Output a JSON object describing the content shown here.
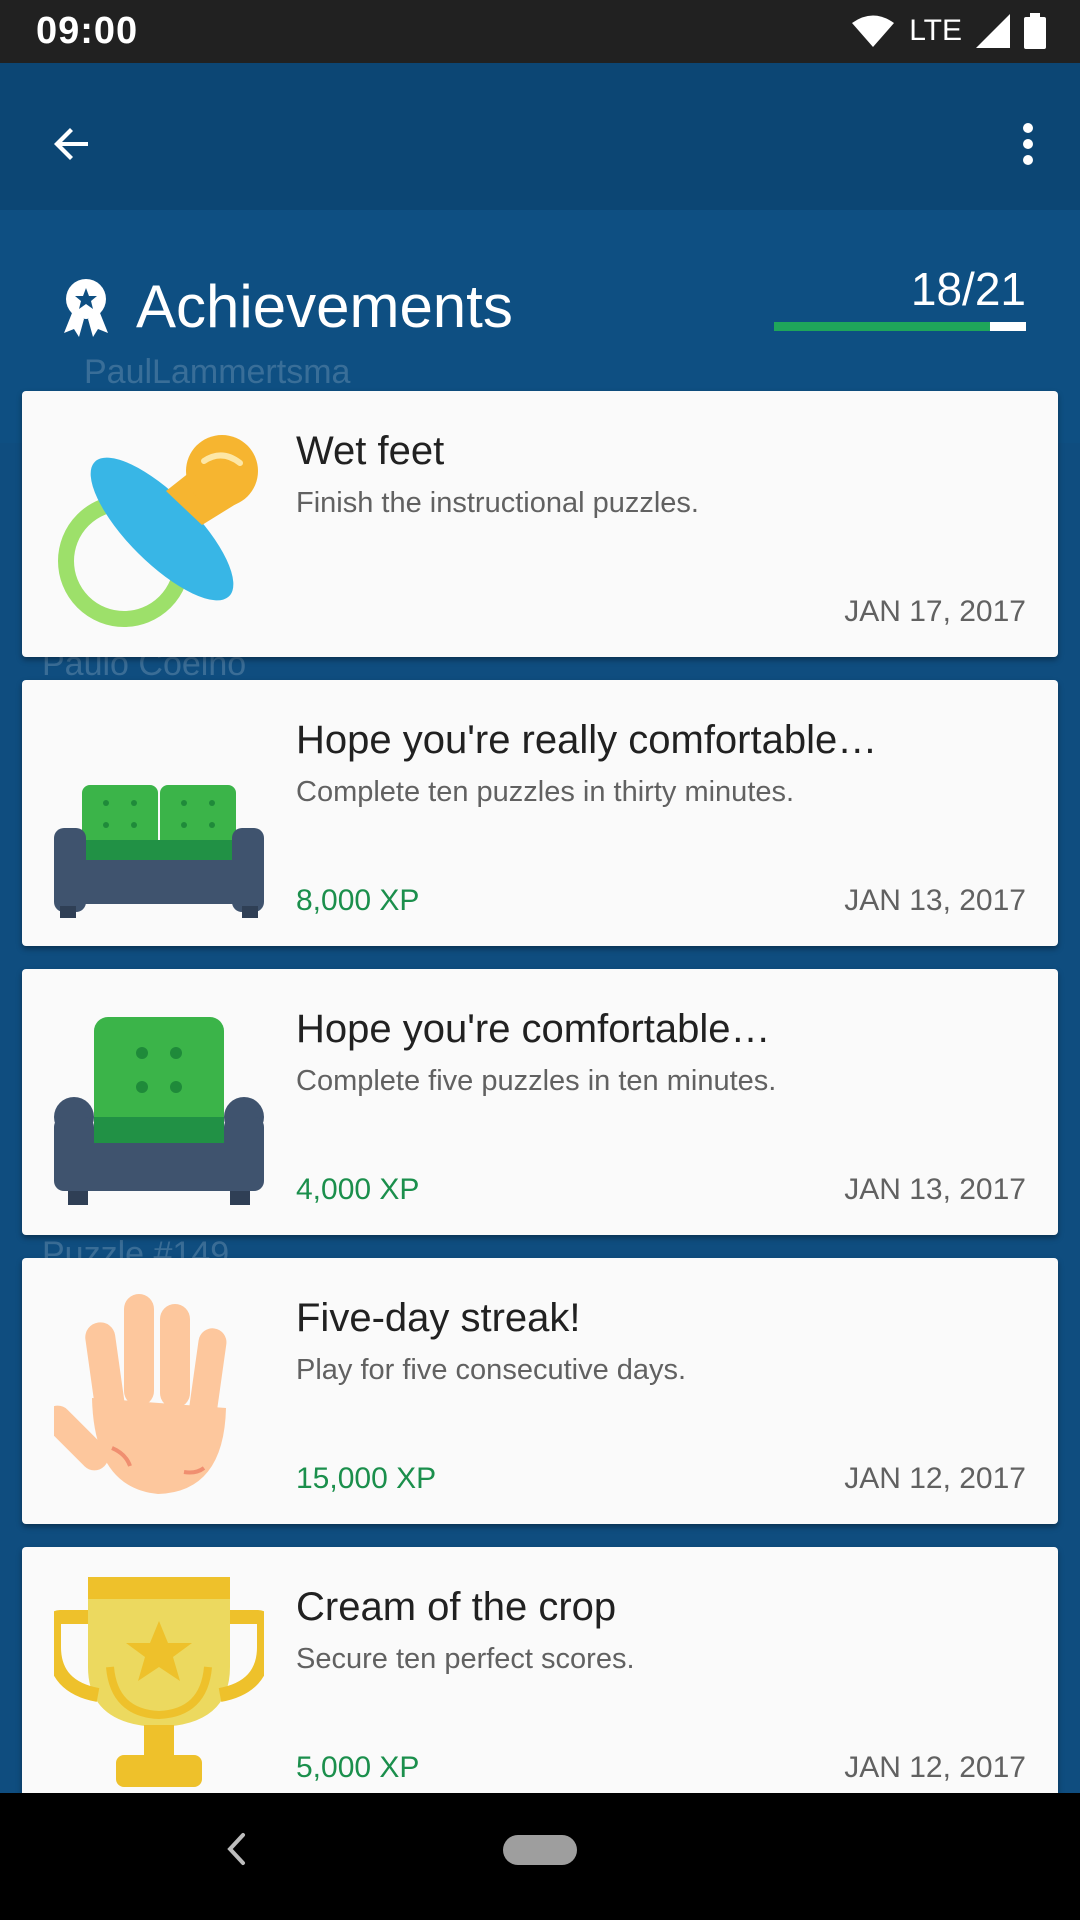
{
  "status_bar": {
    "time": "09:00",
    "network": "LTE"
  },
  "background": {
    "faded_texts": [
      "PaulLammertsma",
      "Paulo Coelho",
      "Puzzle #149"
    ]
  },
  "header": {
    "title": "Achievements",
    "progress_text": "18/21",
    "progress_value": 0.857
  },
  "achievements": [
    {
      "title": "Wet feet",
      "description": "Finish the instructional puzzles.",
      "xp": "",
      "date": "JAN 17, 2017",
      "icon": "pacifier-icon"
    },
    {
      "title": "Hope you're really comfortable…",
      "description": "Complete ten puzzles in thirty minutes.",
      "xp": "8,000 XP",
      "date": "JAN 13, 2017",
      "icon": "sofa-icon"
    },
    {
      "title": "Hope you're comfortable…",
      "description": "Complete five puzzles in ten minutes.",
      "xp": "4,000 XP",
      "date": "JAN 13, 2017",
      "icon": "armchair-icon"
    },
    {
      "title": "Five-day streak!",
      "description": "Play for five consecutive days.",
      "xp": "15,000 XP",
      "date": "JAN 12, 2017",
      "icon": "hand-icon"
    },
    {
      "title": "Cream of the crop",
      "description": "Secure ten perfect scores.",
      "xp": "5,000 XP",
      "date": "JAN 12, 2017",
      "icon": "trophy-icon"
    }
  ],
  "colors": {
    "toolbar": "#0c4674",
    "accent_green": "#1fa55a",
    "xp_text": "#1b8f4c"
  }
}
